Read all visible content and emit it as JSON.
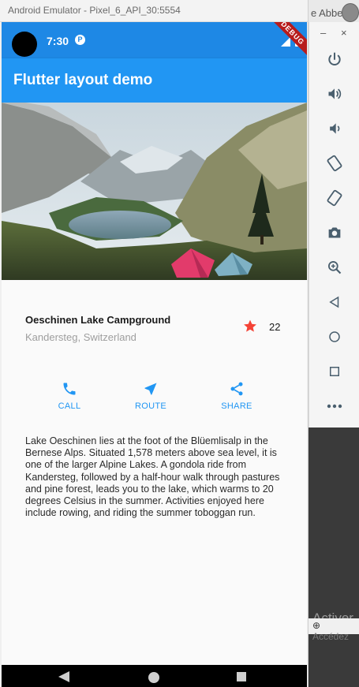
{
  "window": {
    "title": "Android Emulator - Pixel_6_API_30:5554"
  },
  "background": {
    "top_text": "e Abbes",
    "activate_text": "Activer",
    "activate_sub": "Accédez"
  },
  "status_bar": {
    "time": "7:30",
    "debug_banner": "DEBUG"
  },
  "app": {
    "title": "Flutter layout demo",
    "accent_color": "#2196f3",
    "status_color": "#1e88e5"
  },
  "place": {
    "name": "Oeschinen Lake Campground",
    "location": "Kandersteg, Switzerland",
    "favorite_count": "22",
    "favorite_icon": "star-icon",
    "favorite_color": "#f44336"
  },
  "actions": [
    {
      "label": "CALL",
      "icon": "call-icon"
    },
    {
      "label": "ROUTE",
      "icon": "near-me-icon"
    },
    {
      "label": "SHARE",
      "icon": "share-icon"
    }
  ],
  "description": "Lake Oeschinen lies at the foot of the Blüemlisalp in the Bernese Alps. Situated 1,578 meters above sea level, it is one of the larger Alpine Lakes. A gondola ride from Kandersteg, followed by a half-hour walk through pastures and pine forest, leads you to the lake, which warms to 20 degrees Celsius in the summer. Activities enjoyed here include rowing, and riding the summer toboggan run.",
  "emulator_toolbar": {
    "minimize": "–",
    "close": "×",
    "buttons": [
      "power-icon",
      "volume-up-icon",
      "volume-down-icon",
      "rotate-left-icon",
      "rotate-right-icon",
      "camera-icon",
      "zoom-icon",
      "back-icon",
      "home-icon",
      "overview-icon",
      "more-icon"
    ]
  }
}
